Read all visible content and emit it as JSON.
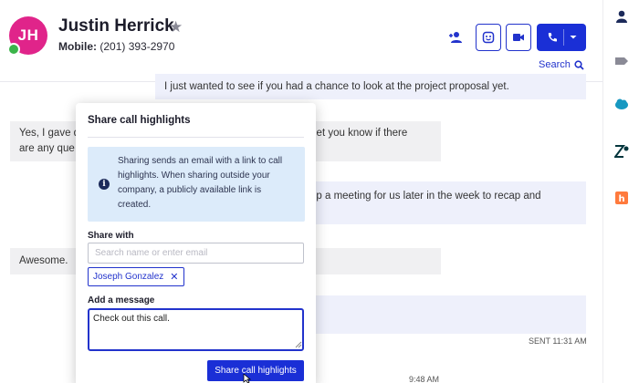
{
  "contact": {
    "initials": "JH",
    "name": "Justin Herrick",
    "phone_label": "Mobile:",
    "phone_number": "(201) 393-2970"
  },
  "header": {
    "search_label": "Search",
    "icons": [
      "add-contact-icon",
      "emoji-icon",
      "video-icon",
      "phone-icon",
      "chevron-down-icon",
      "search-icon"
    ]
  },
  "rail": {
    "icons": [
      "person-icon",
      "tag-icon",
      "salesforce-icon",
      "zendesk-icon",
      "hubspot-icon"
    ]
  },
  "messages": [
    {
      "direction": "out",
      "text": "I just wanted to see if you had a chance to look at the project proposal yet."
    },
    {
      "direction": "in",
      "text_left": "Yes, I gave q",
      "text_left_2": "are any que",
      "text_right": "let you know if there"
    },
    {
      "direction": "out",
      "text": "up a meeting for us later in the week to recap and"
    },
    {
      "direction": "in",
      "text": "Awesome."
    },
    {
      "direction": "out",
      "text": ""
    }
  ],
  "timestamps": {
    "sent": "SENT 11:31 AM",
    "divider": "9:48 AM"
  },
  "modal": {
    "title": "Share call highlights",
    "info_text": "Sharing sends an email with a link to call highlights. When sharing outside your company, a publicly available link is created.",
    "share_with_label": "Share with",
    "share_placeholder": "Search name or enter email",
    "recipient_chip": "Joseph Gonzalez",
    "message_label": "Add a message",
    "message_value": "Check out this call.",
    "submit_label": "Share call highlights"
  },
  "colors": {
    "accent": "#1a2fd6",
    "avatar": "#e0248a",
    "presence": "#3bb44a",
    "info_bg": "#dcebfa",
    "outgoing_bubble": "#eef0fb",
    "incoming_bubble": "#f0f0f2"
  }
}
